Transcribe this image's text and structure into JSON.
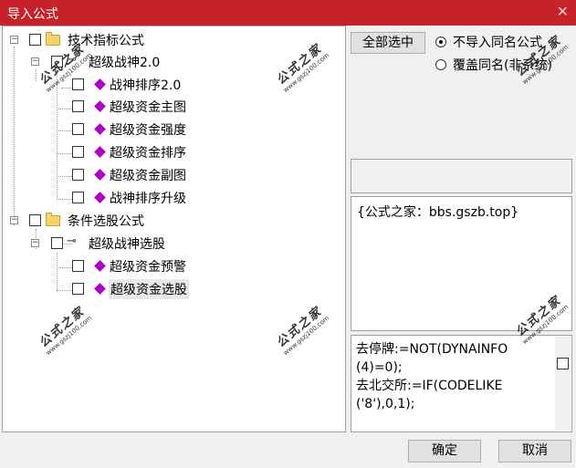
{
  "window": {
    "title": "导入公式",
    "close_glyph": "✕"
  },
  "tree": {
    "nodes": [
      {
        "label": "技术指标公式"
      },
      {
        "label": "超级战神2.0"
      },
      {
        "label": "战神排序2.0"
      },
      {
        "label": "超级资金主图"
      },
      {
        "label": "超级资金强度"
      },
      {
        "label": "超级资金排序"
      },
      {
        "label": "超级资金副图"
      },
      {
        "label": "战神排序升级"
      },
      {
        "label": "条件选股公式"
      },
      {
        "label": "超级战神选股"
      },
      {
        "label": "超级资金预警"
      },
      {
        "label": "超级资金选股"
      }
    ]
  },
  "options": {
    "select_all_label": "全部选中",
    "radio_skip_label": "不导入同名公式",
    "radio_overwrite_label": "覆盖同名(非系统)"
  },
  "description": {
    "text": "{公式之家：bbs.gszb.top}"
  },
  "code": {
    "lines": [
      "去停牌:=NOT(DYNAINFO",
      "(4)=0);",
      "去北交所:=IF(CODELIKE",
      "('8'),0,1);"
    ]
  },
  "footer": {
    "ok_label": "确定",
    "cancel_label": "取消"
  },
  "watermark": {
    "text": "公式之家",
    "url": "www.gszj100.com"
  }
}
